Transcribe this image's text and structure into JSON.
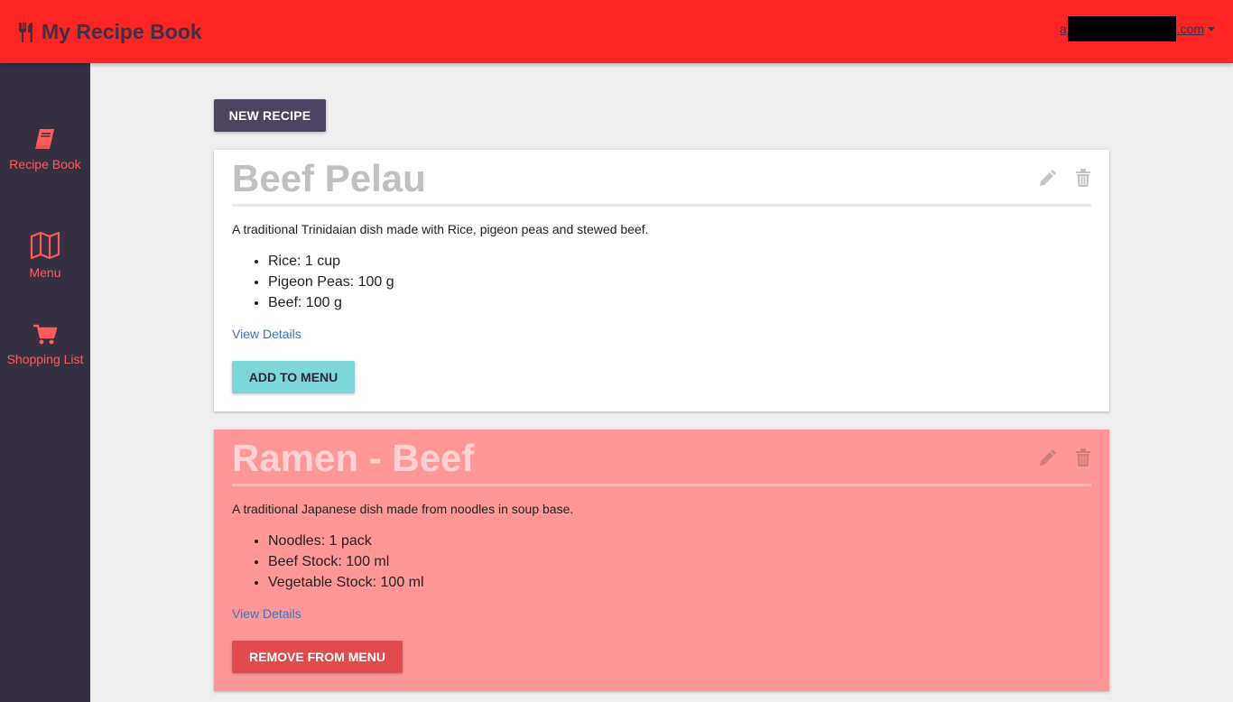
{
  "header": {
    "title": "My Recipe Book",
    "user_prefix": "a",
    "user_suffix": ".com",
    "brand_color": "#ff2424"
  },
  "sidebar": {
    "items": [
      {
        "label": "Recipe Book",
        "icon": "book-icon"
      },
      {
        "label": "Menu",
        "icon": "map-icon"
      },
      {
        "label": "Shopping List",
        "icon": "cart-icon"
      }
    ]
  },
  "toolbar": {
    "new_recipe_label": "NEW RECIPE"
  },
  "recipes": [
    {
      "title": "Beef Pelau",
      "description": "A traditional Trinidaian dish made with Rice, pigeon peas and stewed beef.",
      "ingredients": [
        "Rice: 1 cup",
        "Pigeon Peas: 100 g",
        "Beef: 100 g"
      ],
      "view_details": "View Details",
      "action_label": "ADD TO MENU",
      "on_menu": false
    },
    {
      "title": "Ramen - Beef",
      "description": "A traditional Japanese dish made from noodles in soup base.",
      "ingredients": [
        "Noodles: 1 pack",
        "Beef Stock: 100 ml",
        "Vegetable Stock: 100 ml"
      ],
      "view_details": "View Details",
      "action_label": "REMOVE FROM MENU",
      "on_menu": true
    }
  ]
}
